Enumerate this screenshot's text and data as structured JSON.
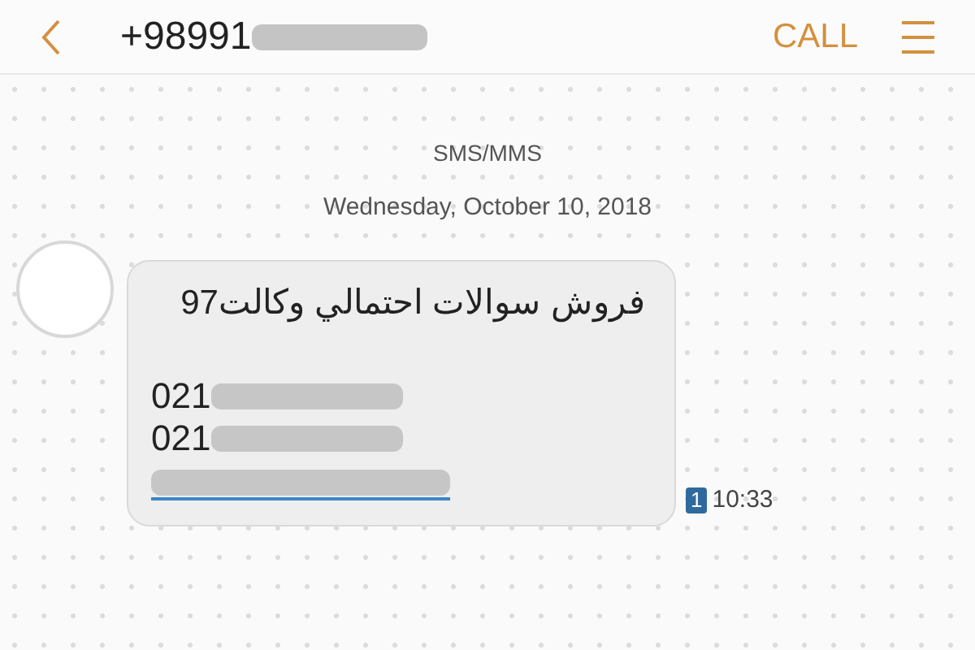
{
  "header": {
    "contact": "+98991",
    "action": "CALL"
  },
  "channel_label": "SMS/MMS",
  "date": "Wednesday, October 10, 2018",
  "message": {
    "lines": [
      {
        "kind": "text",
        "text": "فروش سوالات احتمالي وكالت97"
      },
      {
        "kind": "gap"
      },
      {
        "kind": "partial",
        "text": "021"
      },
      {
        "kind": "partial",
        "text": "021"
      },
      {
        "kind": "redacted_link"
      }
    ],
    "sim": "1",
    "time": "10:33"
  }
}
